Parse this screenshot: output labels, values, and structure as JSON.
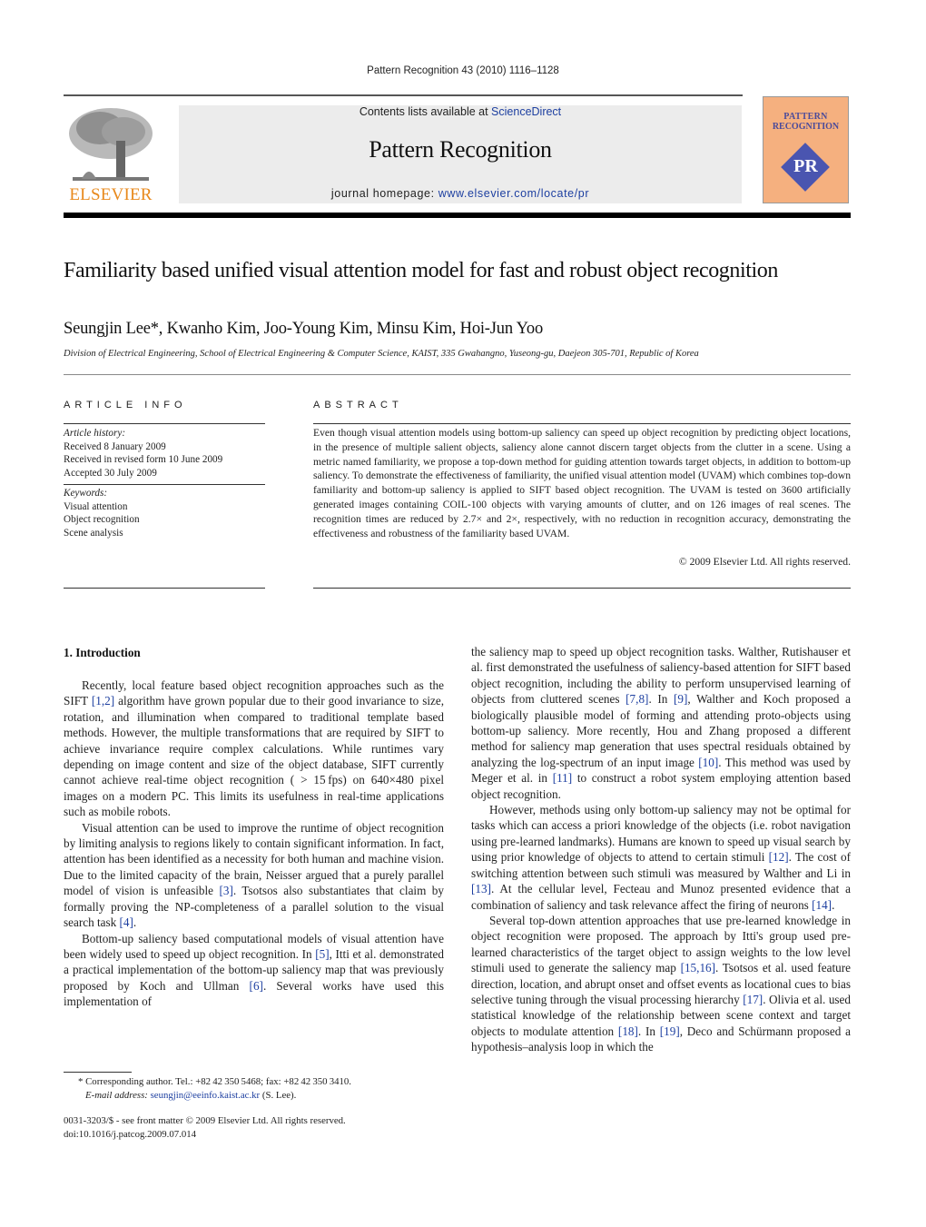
{
  "header": {
    "journal_ref": "Pattern Recognition 43 (2010) 1116–1128",
    "contents_prefix": "Contents lists available at ",
    "contents_link": "ScienceDirect",
    "journal_name": "Pattern Recognition",
    "homepage_prefix": "journal homepage: ",
    "homepage_link": "www.elsevier.com/locate/pr",
    "publisher_logo": "ELSEVIER",
    "cover": {
      "line1": "PATTERN",
      "line2": "RECOGNITION",
      "emblem": "PR"
    },
    "colors": {
      "link": "#1d3fa0",
      "elsevier_orange": "#e8891c",
      "cover_bg": "#f5b07f",
      "banner_bg": "#ececec"
    }
  },
  "article": {
    "title": "Familiarity based unified visual attention model for fast and robust object recognition",
    "authors": "Seungjin Lee*, Kwanho Kim, Joo-Young Kim, Minsu Kim, Hoi-Jun Yoo",
    "affiliation": "Division of Electrical Engineering, School of Electrical Engineering & Computer Science, KAIST, 335 Gwahangno, Yuseong-gu, Daejeon 305-701, Republic of Korea"
  },
  "article_info": {
    "heading": "ARTICLE INFO",
    "history_label": "Article history:",
    "history": [
      "Received 8 January 2009",
      "Received in revised form 10 June 2009",
      "Accepted 30 July 2009"
    ],
    "keywords_label": "Keywords:",
    "keywords": [
      "Visual attention",
      "Object recognition",
      "Scene analysis"
    ]
  },
  "abstract": {
    "heading": "ABSTRACT",
    "text": "Even though visual attention models using bottom-up saliency can speed up object recognition by predicting object locations, in the presence of multiple salient objects, saliency alone cannot discern target objects from the clutter in a scene. Using a metric named familiarity, we propose a top-down method for guiding attention towards target objects, in addition to bottom-up saliency. To demonstrate the effectiveness of familiarity, the unified visual attention model (UVAM) which combines top-down familiarity and bottom-up saliency is applied to SIFT based object recognition. The UVAM is tested on 3600 artificially generated images containing COIL-100 objects with varying amounts of clutter, and on 126 images of real scenes. The recognition times are reduced by 2.7× and 2×, respectively, with no reduction in recognition accuracy, demonstrating the effectiveness and robustness of the familiarity based UVAM.",
    "copyright": "© 2009 Elsevier Ltd. All rights reserved."
  },
  "section": {
    "heading": "1.  Introduction"
  },
  "col1": [
    [
      {
        "t": "Recently, local feature based object recognition approaches such as the SIFT "
      },
      {
        "r": "[1,2]"
      },
      {
        "t": " algorithm have grown popular due to their good invariance to size, rotation, and illumination when compared to traditional template based methods. However, the multiple transformations that are required by SIFT to achieve invariance require complex calculations. While runtimes vary depending on image content and size of the object database, SIFT currently cannot achieve real-time object recognition ( > 15 fps) on 640×480 pixel images on a modern PC. This limits its usefulness in real-time applications such as mobile robots."
      }
    ],
    [
      {
        "t": "Visual attention can be used to improve the runtime of object recognition by limiting analysis to regions likely to contain significant information. In fact, attention has been identified as a necessity for both human and machine vision. Due to the limited capacity of the brain, Neisser argued that a purely parallel model of vision is unfeasible "
      },
      {
        "r": "[3]"
      },
      {
        "t": ". Tsotsos also substantiates that claim by formally proving the NP-completeness of a parallel solution to the visual search task "
      },
      {
        "r": "[4]"
      },
      {
        "t": "."
      }
    ],
    [
      {
        "t": "Bottom-up saliency based computational models of visual attention have been widely used to speed up object recognition. In "
      },
      {
        "r": "[5]"
      },
      {
        "t": ", Itti et al. demonstrated a practical implementation of the bottom-up saliency map that was previously proposed by Koch and Ullman "
      },
      {
        "r": "[6]"
      },
      {
        "t": ". Several works have used this implementation of"
      }
    ]
  ],
  "col2": [
    [
      {
        "t": "the saliency map to speed up object recognition tasks. Walther, Rutishauser et al. first demonstrated the usefulness of saliency-based attention for SIFT based object recognition, including the ability to perform unsupervised learning of objects from cluttered scenes "
      },
      {
        "r": "[7,8]"
      },
      {
        "t": ". In "
      },
      {
        "r": "[9]"
      },
      {
        "t": ", Walther and Koch proposed a biologically plausible model of forming and attending proto-objects using bottom-up saliency. More recently, Hou and Zhang proposed a different method for saliency map generation that uses spectral residuals obtained by analyzing the log-spectrum of an input image "
      },
      {
        "r": "[10]"
      },
      {
        "t": ". This method was used by Meger et al. in "
      },
      {
        "r": "[11]"
      },
      {
        "t": " to construct a robot system employing attention based object recognition."
      }
    ],
    [
      {
        "t": "However, methods using only bottom-up saliency may not be optimal for tasks which can access a priori knowledge of the objects (i.e. robot navigation using pre-learned landmarks). Humans are known to speed up visual search by using prior knowledge of objects to attend to certain stimuli "
      },
      {
        "r": "[12]"
      },
      {
        "t": ". The cost of switching attention between such stimuli was measured by Walther and Li in "
      },
      {
        "r": "[13]"
      },
      {
        "t": ". At the cellular level, Fecteau and Munoz presented evidence that a combination of saliency and task relevance affect the firing of neurons "
      },
      {
        "r": "[14]"
      },
      {
        "t": "."
      }
    ],
    [
      {
        "t": "Several top-down attention approaches that use pre-learned knowledge in object recognition were proposed. The approach by Itti's group used pre-learned characteristics of the target object to assign weights to the low level stimuli used to generate the saliency map "
      },
      {
        "r": "[15,16]"
      },
      {
        "t": ". Tsotsos et al. used feature direction, location, and abrupt onset and offset events as locational cues to bias selective tuning through the visual processing hierarchy "
      },
      {
        "r": "[17]"
      },
      {
        "t": ". Olivia et al. used statistical knowledge of the relationship between scene context and target objects to modulate attention "
      },
      {
        "r": "[18]"
      },
      {
        "t": ". In "
      },
      {
        "r": "[19]"
      },
      {
        "t": ", Deco and Schürmann proposed a hypothesis–analysis loop in which the"
      }
    ]
  ],
  "footnote": {
    "line1": "* Corresponding author. Tel.: +82 42 350 5468; fax: +82 42 350 3410.",
    "email_label": "E-mail address: ",
    "email": "seungjin@eeinfo.kaist.ac.kr",
    "email_suffix": " (S. Lee)."
  },
  "front_matter": {
    "line1": "0031-3203/$ - see front matter © 2009 Elsevier Ltd. All rights reserved.",
    "doi": "doi:10.1016/j.patcog.2009.07.014"
  }
}
